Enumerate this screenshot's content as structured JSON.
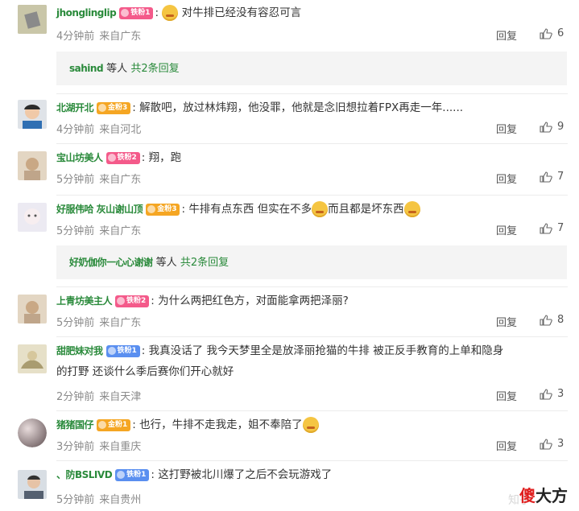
{
  "labels": {
    "reply": "回复",
    "others_suffix": "等人",
    "colon": ":"
  },
  "comments": [
    {
      "user": "jhonglinglip",
      "badge": "铁粉1",
      "text": "对牛排已经没有容忍可言",
      "time": "4分钟前",
      "loc": "来自广东",
      "likes": "6"
    },
    {
      "user": "北湖开北",
      "badge": "金粉3",
      "text": "解散吧，放过林炜翔，他没罪，他就是念旧想拉着FPX再走一年......",
      "time": "4分钟前",
      "loc": "来自河北",
      "likes": "9"
    },
    {
      "user": "宝山坊美人",
      "badge": "铁粉2",
      "text": "翔，跑",
      "time": "5分钟前",
      "loc": "来自广东",
      "likes": "7"
    },
    {
      "user": "好服伟哈 灰山谢山顶",
      "badge": "金粉3",
      "text": "牛排有点东西 但实在不多",
      "text2": "而且都是坏东西",
      "time": "5分钟前",
      "loc": "来自广东",
      "likes": "7"
    },
    {
      "user": "上青坊美主人",
      "badge": "铁粉2",
      "text": "为什么两把红色方，对面能拿两把泽丽?",
      "time": "5分钟前",
      "loc": "来自广东",
      "likes": "8"
    },
    {
      "user": "甜肥妹对我",
      "badge": "铁粉1",
      "text": "我真没话了 我今天梦里全是放泽丽抢猫的牛排 被正反手教育的上单和隐身",
      "text2": "的打野 还谈什么季后赛你们开心就好",
      "time": "2分钟前",
      "loc": "来自天津",
      "likes": "3"
    },
    {
      "user": "猪猪国仔",
      "badge": "金粉1",
      "text": "也行，牛排不走我走，姐不奉陪了",
      "time": "3分钟前",
      "loc": "来自重庆",
      "likes": "3"
    },
    {
      "user": "、防BSLIVD",
      "badge": "铁粉1",
      "text": "这打野被北川爆了之后不会玩游戏了",
      "time": "5分钟前",
      "loc": "来自贵州",
      "likes": ""
    }
  ],
  "sub_replies": [
    {
      "names": "sahind",
      "count": "共2条回复"
    },
    {
      "names": "好奶伽你一心心谢谢",
      "count": "共2条回复"
    }
  ],
  "watermark": {
    "brand_red": "傻",
    "brand_dark": "大方",
    "faint": "知乎"
  },
  "colors": {
    "username": "#2a8a3b",
    "badge_pink": "#f45a8a",
    "badge_gold": "#f5a623",
    "badge_blue": "#5a8ff0"
  }
}
